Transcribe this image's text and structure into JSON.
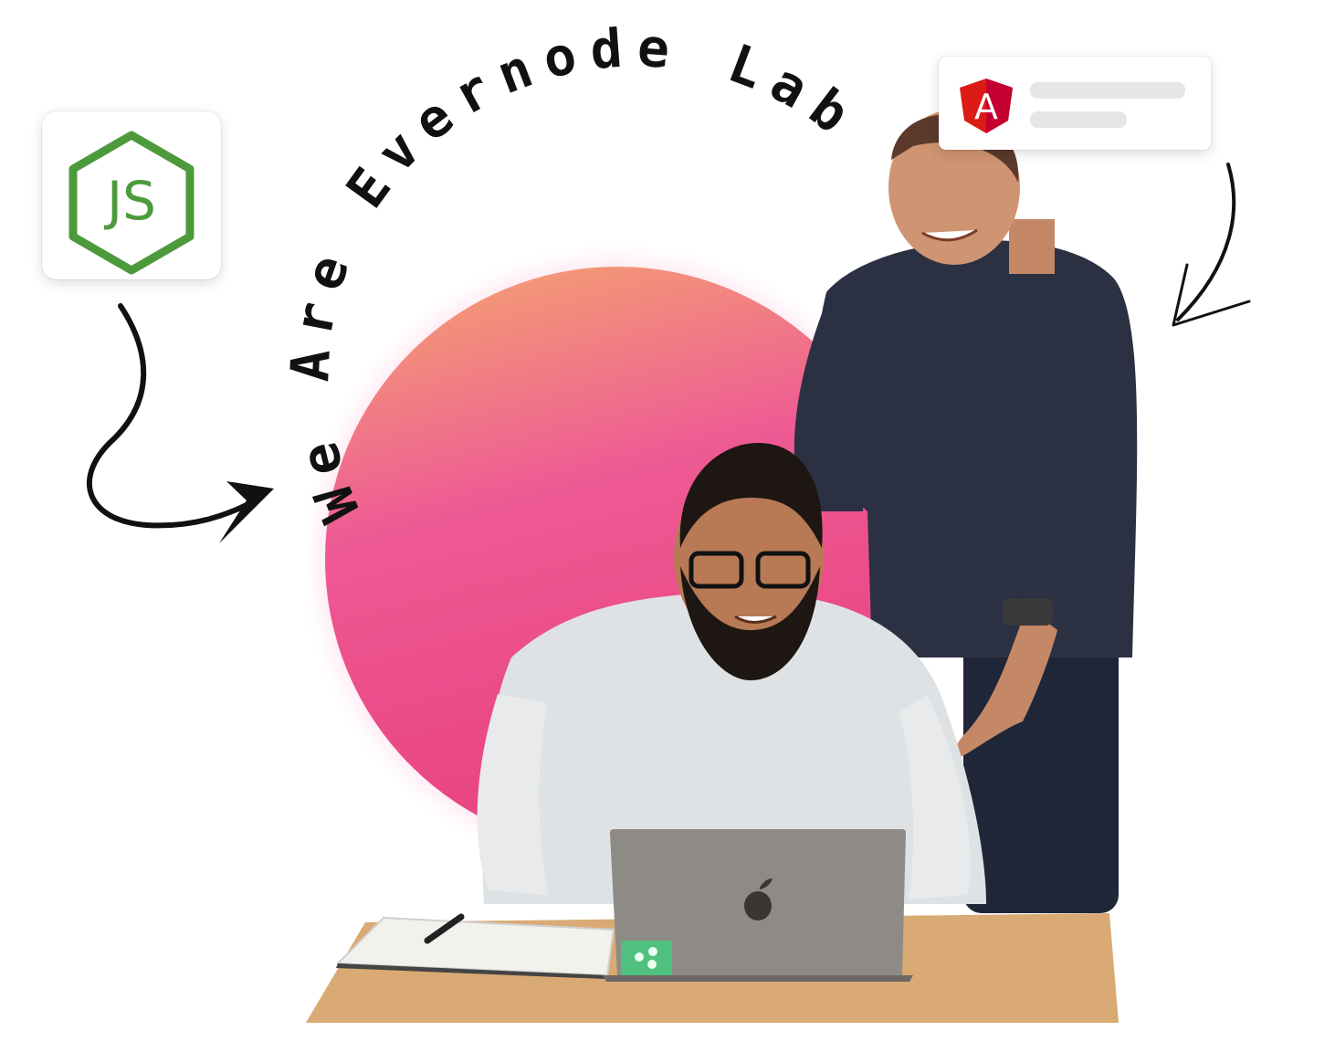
{
  "headline": "We Are Evernode Lab",
  "badges": {
    "node": {
      "text": "JS",
      "icon": "nodejs-icon",
      "color": "#4c9a3c"
    },
    "angular": {
      "text": "A",
      "icon": "angular-icon",
      "color": "#dd1b16"
    }
  },
  "colors": {
    "circle_top": "#f5a870",
    "circle_mid": "#ee5a94",
    "circle_bottom": "#e8427f",
    "arrow": "#111111"
  },
  "images": {
    "photo": "two-developers-at-laptop-photo",
    "laptop_logo": "apple-logo"
  }
}
